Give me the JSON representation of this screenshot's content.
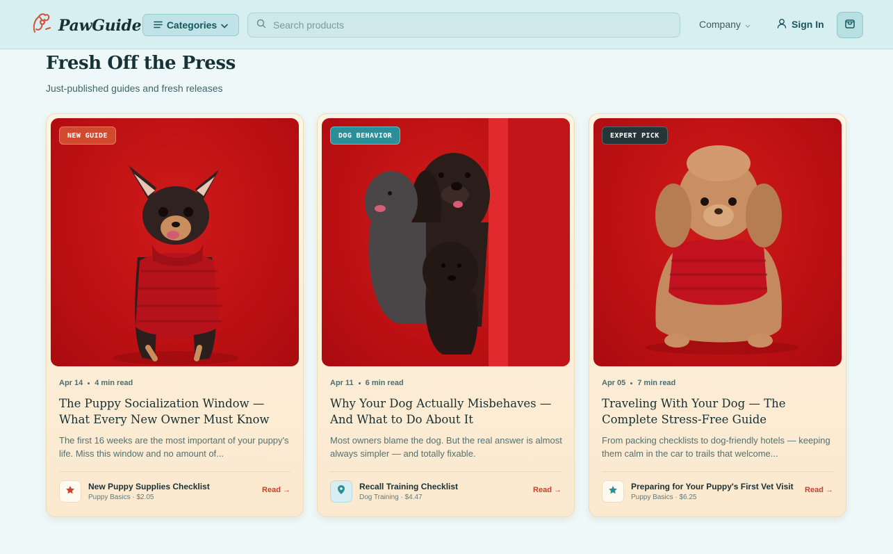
{
  "header": {
    "brand": "PawGuide",
    "categories_label": "Categories",
    "search_placeholder": "Search products",
    "company_label": "Company",
    "signin_label": "Sign In"
  },
  "section": {
    "title": "Fresh Off the Press",
    "subtitle": "Just-published guides and fresh releases"
  },
  "colors": {
    "accent_teal": "#17565d",
    "read_link": "#c6402a",
    "badge_new_guide": "#d24a2d",
    "badge_dog_behavior": "#2a8f98",
    "badge_expert_pick": "#263638"
  },
  "cards": [
    {
      "badge": "NEW GUIDE",
      "image_icon": "chihuahua-in-red-sweater-photo",
      "date": "Apr 14",
      "read_time": "4 min read",
      "title": "The Puppy Socialization Window — What Every New Owner Must Know",
      "description": "The first 16 weeks are the most important of your puppy's life. Miss this window and no amount of...",
      "product_icon": "star-icon",
      "product_name": "New Puppy Supplies Checklist",
      "product_meta": "Puppy Basics · $2.05",
      "read_label": "Read →"
    },
    {
      "badge": "DOG BEHAVIOR",
      "image_icon": "three-doodles-photo",
      "date": "Apr 11",
      "read_time": "6 min read",
      "title": "Why Your Dog Actually Misbehaves — And What to Do About It",
      "description": "Most owners blame the dog. But the real answer is almost always simpler — and totally fixable.",
      "product_icon": "map-pin-icon",
      "product_name": "Recall Training Checklist",
      "product_meta": "Dog Training · $4.47",
      "read_label": "Read →"
    },
    {
      "badge": "EXPERT PICK",
      "image_icon": "poodle-in-red-sweater-photo",
      "date": "Apr 05",
      "read_time": "7 min read",
      "title": "Traveling With Your Dog — The Complete Stress-Free Guide",
      "description": "From packing checklists to dog-friendly hotels — keeping them calm in the car to trails that welcome...",
      "product_icon": "star-icon",
      "product_name": "Preparing for Your Puppy's First Vet Visit",
      "product_meta": "Puppy Basics · $6.25",
      "read_label": "Read →"
    }
  ]
}
